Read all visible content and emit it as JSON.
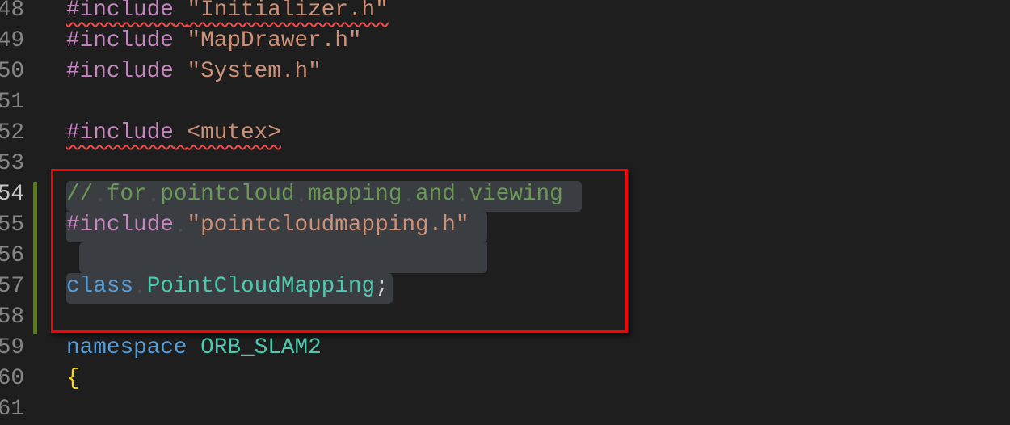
{
  "editor": {
    "lines": [
      {
        "number": "48",
        "tokens": [
          "#include",
          "\"Initializer.h\""
        ]
      },
      {
        "number": "49",
        "tokens": [
          "#include",
          "\"MapDrawer.h\""
        ]
      },
      {
        "number": "50",
        "tokens": [
          "#include",
          "\"System.h\""
        ]
      },
      {
        "number": "51",
        "tokens": []
      },
      {
        "number": "52",
        "tokens": [
          "#include",
          "<mutex>"
        ]
      },
      {
        "number": "53",
        "tokens": []
      },
      {
        "number": "54",
        "tokens": [
          "//",
          "for",
          "pointcloud",
          "mapping",
          "and",
          "viewing"
        ]
      },
      {
        "number": "55",
        "tokens": [
          "#include",
          "\"pointcloudmapping.h\""
        ]
      },
      {
        "number": "56",
        "tokens": []
      },
      {
        "number": "57",
        "tokens": [
          "class",
          "PointCloudMapping",
          ";"
        ]
      },
      {
        "number": "58",
        "tokens": []
      },
      {
        "number": "59",
        "tokens": [
          "namespace",
          "ORB_SLAM2"
        ]
      },
      {
        "number": "60",
        "tokens": [
          "{"
        ]
      },
      {
        "number": "61",
        "tokens": []
      }
    ],
    "colors": {
      "highlight_box": "#ff0000",
      "modified_gutter": "#587c0c",
      "selection": "#3a3d41"
    }
  }
}
